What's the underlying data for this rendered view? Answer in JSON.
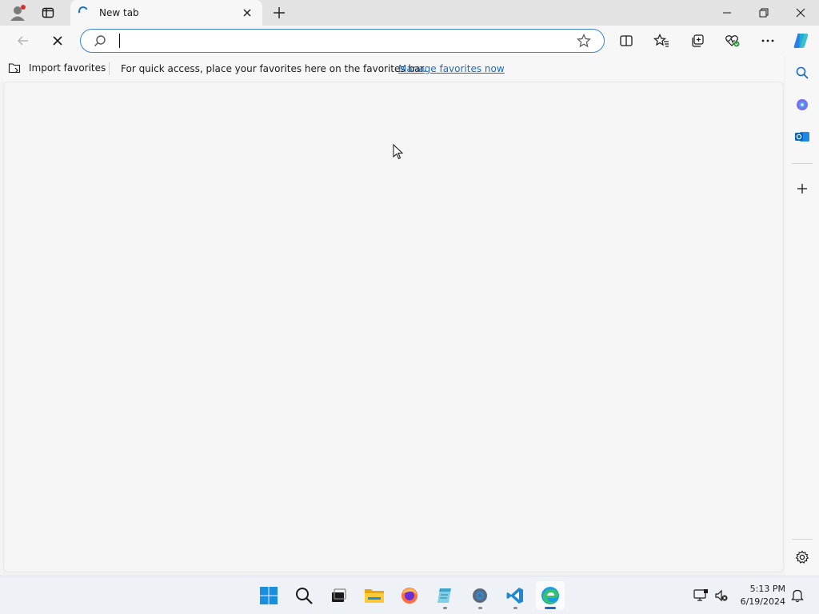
{
  "browser": {
    "tab": {
      "title": "New tab"
    },
    "address_bar": {
      "value": "",
      "placeholder": ""
    },
    "favorites_bar": {
      "import_label": "Import favorites",
      "message": "For quick access, place your favorites here on the favorites bar.",
      "manage_link": "Manage favorites now"
    },
    "toolbar_icons": [
      "back-icon",
      "stop-loading-icon",
      "split-screen-icon",
      "favorites-icon",
      "collections-icon",
      "browser-essentials-icon",
      "more-icon",
      "copilot-icon"
    ],
    "sidebar_icons": [
      "search-icon",
      "copilot-app-icon",
      "outlook-icon",
      "add-icon",
      "settings-icon"
    ]
  },
  "taskbar": {
    "apps": [
      "windows-start-icon",
      "search-icon",
      "task-view-icon",
      "file-explorer-icon",
      "firefox-icon",
      "notepad-icon",
      "settings-icon",
      "vscode-icon",
      "edge-icon"
    ],
    "clock": {
      "time": "5:13 PM",
      "date": "6/19/2024"
    }
  },
  "colors": {
    "accent": "#1a6bc5",
    "address_border": "#3b82d6",
    "background": "#f3f3f3"
  }
}
